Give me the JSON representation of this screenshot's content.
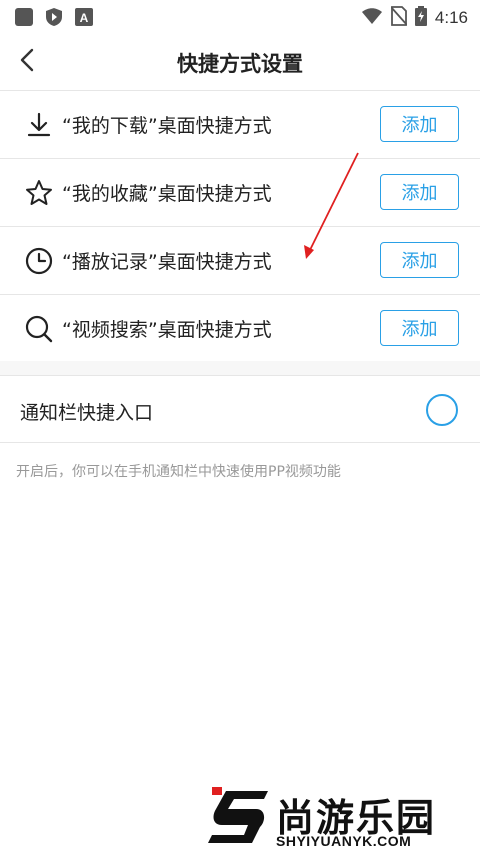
{
  "status_bar": {
    "time": "4:16",
    "icons": [
      "app-square-icon",
      "shield-play-icon",
      "a-box-icon",
      "wifi-icon",
      "no-sim-icon",
      "battery-charging-icon"
    ]
  },
  "header": {
    "title": "快捷方式设置",
    "back_icon": "chevron-left-icon"
  },
  "shortcuts": [
    {
      "icon": "download-icon",
      "label": "“我的下载”桌面快捷方式",
      "button": "添加"
    },
    {
      "icon": "star-icon",
      "label": "“我的收藏”桌面快捷方式",
      "button": "添加"
    },
    {
      "icon": "clock-icon",
      "label": "“播放记录”桌面快捷方式",
      "button": "添加"
    },
    {
      "icon": "search-icon",
      "label": "“视频搜索”桌面快捷方式",
      "button": "添加"
    }
  ],
  "notification": {
    "label": "通知栏快捷入口",
    "enabled": false
  },
  "hint": "开启后，你可以在手机通知栏中快速使用PP视频功能",
  "watermark": {
    "name": "尚游乐园",
    "url": "SHYIYUANYK.COM"
  },
  "colors": {
    "accent": "#2aa0e6",
    "arrow": "#e02020",
    "divider": "#e6e6e6",
    "hint": "#999999"
  }
}
